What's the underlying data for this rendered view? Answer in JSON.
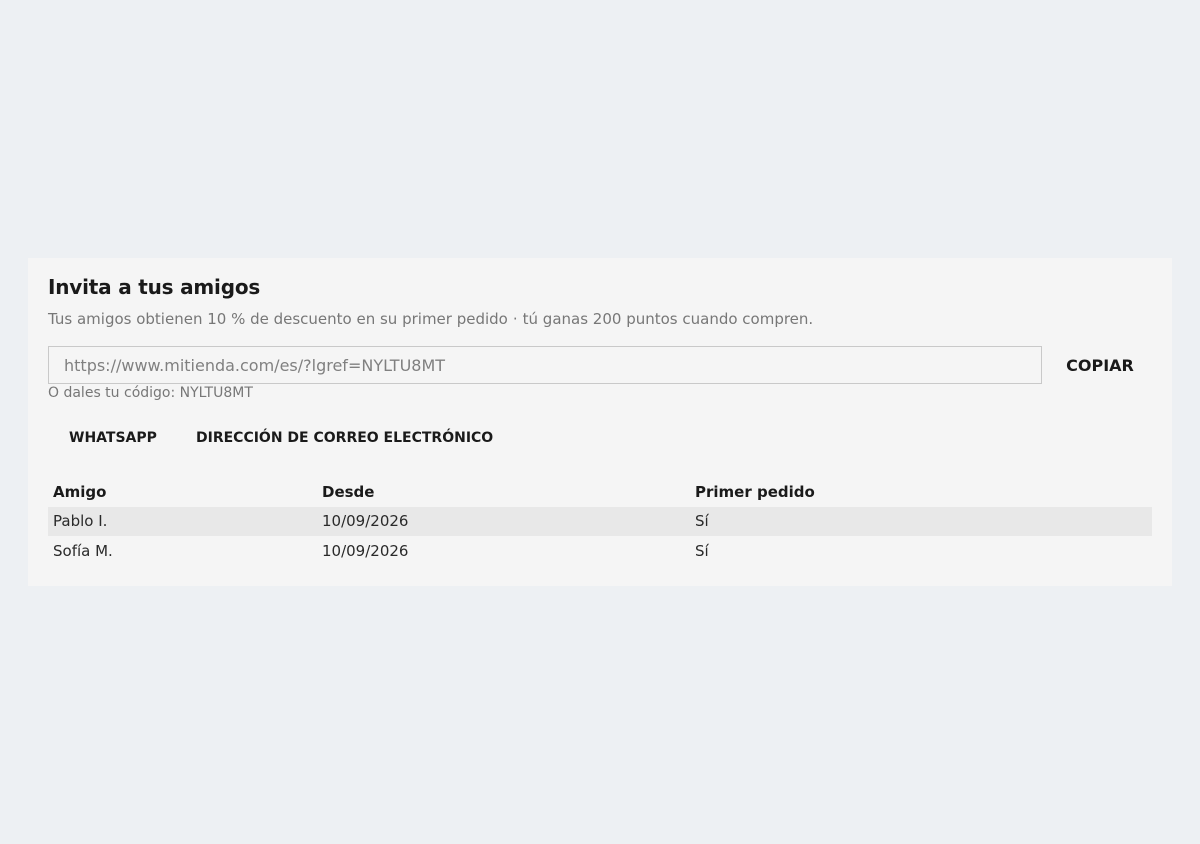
{
  "invite": {
    "title": "Invita a tus amigos",
    "subtitle_part1": "Tus amigos obtienen 10 % de descuento en su primer pedido",
    "subtitle_separator": "·",
    "subtitle_part2": "tú ganas 200 puntos cuando compren.",
    "url_value": "https://www.mitienda.com/es/?lgref=NYLTU8MT",
    "copy_label": "COPIAR",
    "code_text": "O dales tu código: NYLTU8MT"
  },
  "share": {
    "whatsapp_label": "WHATSAPP",
    "email_label": "DIRECCIÓN DE CORREO ELECTRÓNICO"
  },
  "friends_table": {
    "headers": [
      "Amigo",
      "Desde",
      "Primer pedido"
    ],
    "rows": [
      [
        "Pablo I.",
        "10/09/2026",
        "Sí"
      ],
      [
        "Sofía M.",
        "10/09/2026",
        "Sí"
      ]
    ]
  },
  "colors": {
    "page_background": "#edf0f3",
    "card_background": "#f5f5f5",
    "row_highlight": "#e8e8e8",
    "muted_text": "#777777"
  }
}
